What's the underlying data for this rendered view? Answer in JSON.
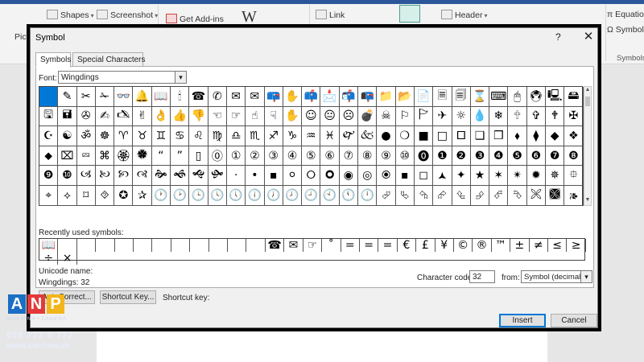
{
  "ribbon": {
    "items": [
      {
        "name": "shapes-button",
        "label": "Shapes",
        "icon": "gray"
      },
      {
        "name": "screenshot-button",
        "label": "Screenshot",
        "icon": "gray"
      },
      {
        "name": "get-addins-button",
        "label": "Get Add-ins",
        "icon": "red"
      },
      {
        "name": "wikipedia-button",
        "label": "W",
        "icon": ""
      },
      {
        "name": "link-button",
        "label": "Link",
        "icon": "gray"
      },
      {
        "name": "header-button",
        "label": "Header",
        "icon": "gray"
      },
      {
        "name": "equation-button",
        "label": "Equation",
        "icon": "gray"
      },
      {
        "name": "symbol-button",
        "label": "Symbol",
        "icon": "gray"
      }
    ],
    "pictures_label": "Pic",
    "symbols_group_label": "Symbols"
  },
  "dialog": {
    "title": "Symbol",
    "help": "?",
    "close": "✕",
    "tabs": [
      "Symbols",
      "Special Characters"
    ],
    "font_label": "Font:",
    "font_value": "Wingdings",
    "grid_rows": [
      [
        "",
        "✎",
        "✂",
        "✁",
        "👓",
        "🔔",
        "📖",
        "🕯",
        "☎",
        "✆",
        "✉",
        "✉",
        "📪",
        "✋",
        "📫",
        "📩",
        "📬",
        "📭",
        "📁",
        "📂",
        "📄",
        "🗏",
        "🗐",
        "⌛",
        "⌨",
        "🖱",
        "🖲",
        "🖳",
        "🖴"
      ],
      [
        "🖫",
        "🖬",
        "✇",
        "✍",
        "🖎",
        "✌",
        "👌",
        "👍",
        "👎",
        "☜",
        "☞",
        "☝",
        "☟",
        "✋",
        "☺",
        "😐",
        "☹",
        "💣",
        "☠",
        "⚐",
        "🏱",
        "✈",
        "☼",
        "💧",
        "❄",
        "🕆",
        "✞",
        "🕈",
        "✠"
      ],
      [
        "☪",
        "☯",
        "ॐ",
        "☸",
        "♈",
        "♉",
        "♊",
        "♋",
        "♌",
        "♍",
        "♎",
        "♏",
        "♐",
        "♑",
        "♒",
        "♓",
        "🙰",
        "🙵",
        "●",
        "❍",
        "■",
        "□",
        "🞐",
        "❑",
        "❒",
        "⬧",
        "⧫",
        "◆",
        "❖"
      ],
      [
        "⬥",
        "⌧",
        "⮹",
        "⌘",
        "🏵",
        "🏶",
        "“",
        "”",
        "▯",
        "⓪",
        "①",
        "②",
        "③",
        "④",
        "⑤",
        "⑥",
        "⑦",
        "⑧",
        "⑨",
        "⑩",
        "⓿",
        "❶",
        "❷",
        "❸",
        "❹",
        "❺",
        "❻",
        "❼",
        "❽"
      ],
      [
        "❾",
        "❿",
        "🙢",
        "🙠",
        "🙡",
        "🙣",
        "🙞",
        "🙜",
        "🙝",
        "🙟",
        "·",
        "•",
        "▪",
        "⚪",
        "🞆",
        "🞈",
        "◉",
        "◎",
        "🞊",
        "▪",
        "◻",
        "🟂",
        "✦",
        "★",
        "✶",
        "✴",
        "✹",
        "✵",
        "⯐"
      ],
      [
        "⌖",
        "⟡",
        "⌑",
        "⯑",
        "✪",
        "✰",
        "🕐",
        "🕑",
        "🕒",
        "🕓",
        "🕔",
        "🕕",
        "🕖",
        "🕗",
        "🕘",
        "🕙",
        "🕚",
        "🕛",
        "⮰",
        "⮱",
        "⮲",
        "⮳",
        "⮴",
        "⮵",
        "⮶",
        "⮷",
        "🙪",
        "🙫",
        "🙕"
      ]
    ],
    "recent_label": "Recently used symbols:",
    "recent": [
      "📖",
      "",
      "",
      "",
      "",
      "",
      "",
      "",
      "",
      "",
      "",
      "",
      "☎",
      "✉",
      "☞",
      "˚",
      "=",
      "=",
      "=",
      "€",
      "£",
      "¥",
      "©",
      "®",
      "™",
      "±",
      "≠",
      "≤",
      "≥",
      "÷",
      "×"
    ],
    "unicode_name_label": "Unicode name:",
    "unicode_value": "Wingdings: 32",
    "char_code_label": "Character code:",
    "char_code_value": "32",
    "from_label": "from:",
    "from_value": "Symbol (decimal)",
    "autocorrect_label": "AutoCorrect...",
    "shortcut_key_button": "Shortcut Key...",
    "shortcut_key_text": "Shortcut key:",
    "insert_label": "Insert",
    "cancel_label": "Cancel"
  },
  "watermark": {
    "letters": [
      "A",
      "N",
      "P"
    ],
    "subtitle": "MÀN HÌNH • CAMERA",
    "phone": "098 772 0 772",
    "website": "WWW.ANP.COM.VN"
  }
}
